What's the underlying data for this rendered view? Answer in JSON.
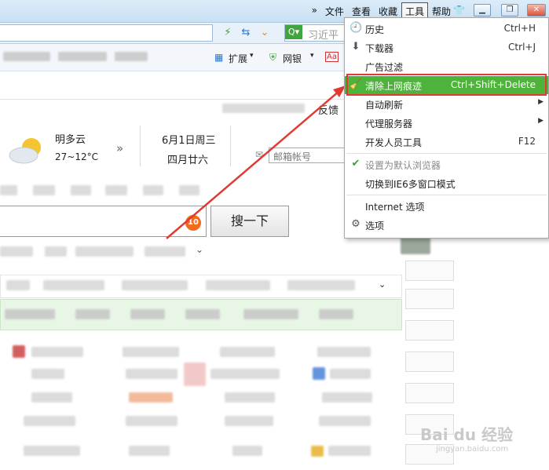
{
  "menubar": {
    "overflow": "»",
    "items": [
      "文件",
      "查看",
      "收藏",
      "工具",
      "帮助"
    ],
    "active_index": 3
  },
  "window_controls": [
    "▁",
    "❐",
    "✕"
  ],
  "address": {
    "search_placeholder": "习近平"
  },
  "favorites": {
    "extend": "扩展",
    "bank": "网银"
  },
  "weather": {
    "condition": "明多云",
    "temp": "27~12°C"
  },
  "date": {
    "gregorian": "6月1日周三",
    "lunar": "四月廿六"
  },
  "mail": {
    "placeholder": "邮箱帐号"
  },
  "feedback": "反馈",
  "search": {
    "button": "搜一下"
  },
  "badge": "10",
  "tools_menu": {
    "items": [
      {
        "icon": "clock-icon",
        "label": "历史",
        "shortcut": "Ctrl+H"
      },
      {
        "icon": "download-icon",
        "label": "下载器",
        "shortcut": "Ctrl+J"
      },
      {
        "icon": "",
        "label": "广告过滤",
        "shortcut": ""
      },
      {
        "icon": "broom-icon",
        "label": "清除上网痕迹",
        "shortcut": "Ctrl+Shift+Delete",
        "selected": true
      },
      {
        "icon": "",
        "label": "自动刷新",
        "shortcut": "",
        "submenu": true
      },
      {
        "icon": "",
        "label": "代理服务器",
        "shortcut": "",
        "submenu": true
      },
      {
        "icon": "",
        "label": "开发人员工具",
        "shortcut": "F12"
      },
      {
        "icon": "check-icon",
        "label": "设置为默认浏览器",
        "shortcut": "",
        "disabled": true
      },
      {
        "icon": "",
        "label": "切换到IE6多窗口模式",
        "shortcut": ""
      },
      {
        "icon": "",
        "label": "Internet 选项",
        "shortcut": ""
      },
      {
        "icon": "gear-icon",
        "label": "选项",
        "shortcut": ""
      }
    ]
  },
  "watermark": {
    "brand": "Bai du 经验",
    "url": "jingyan.baidu.com"
  },
  "colors": {
    "highlight": "#4eb33a",
    "annotation": "#e23a32",
    "badge": "#f26a1b"
  }
}
